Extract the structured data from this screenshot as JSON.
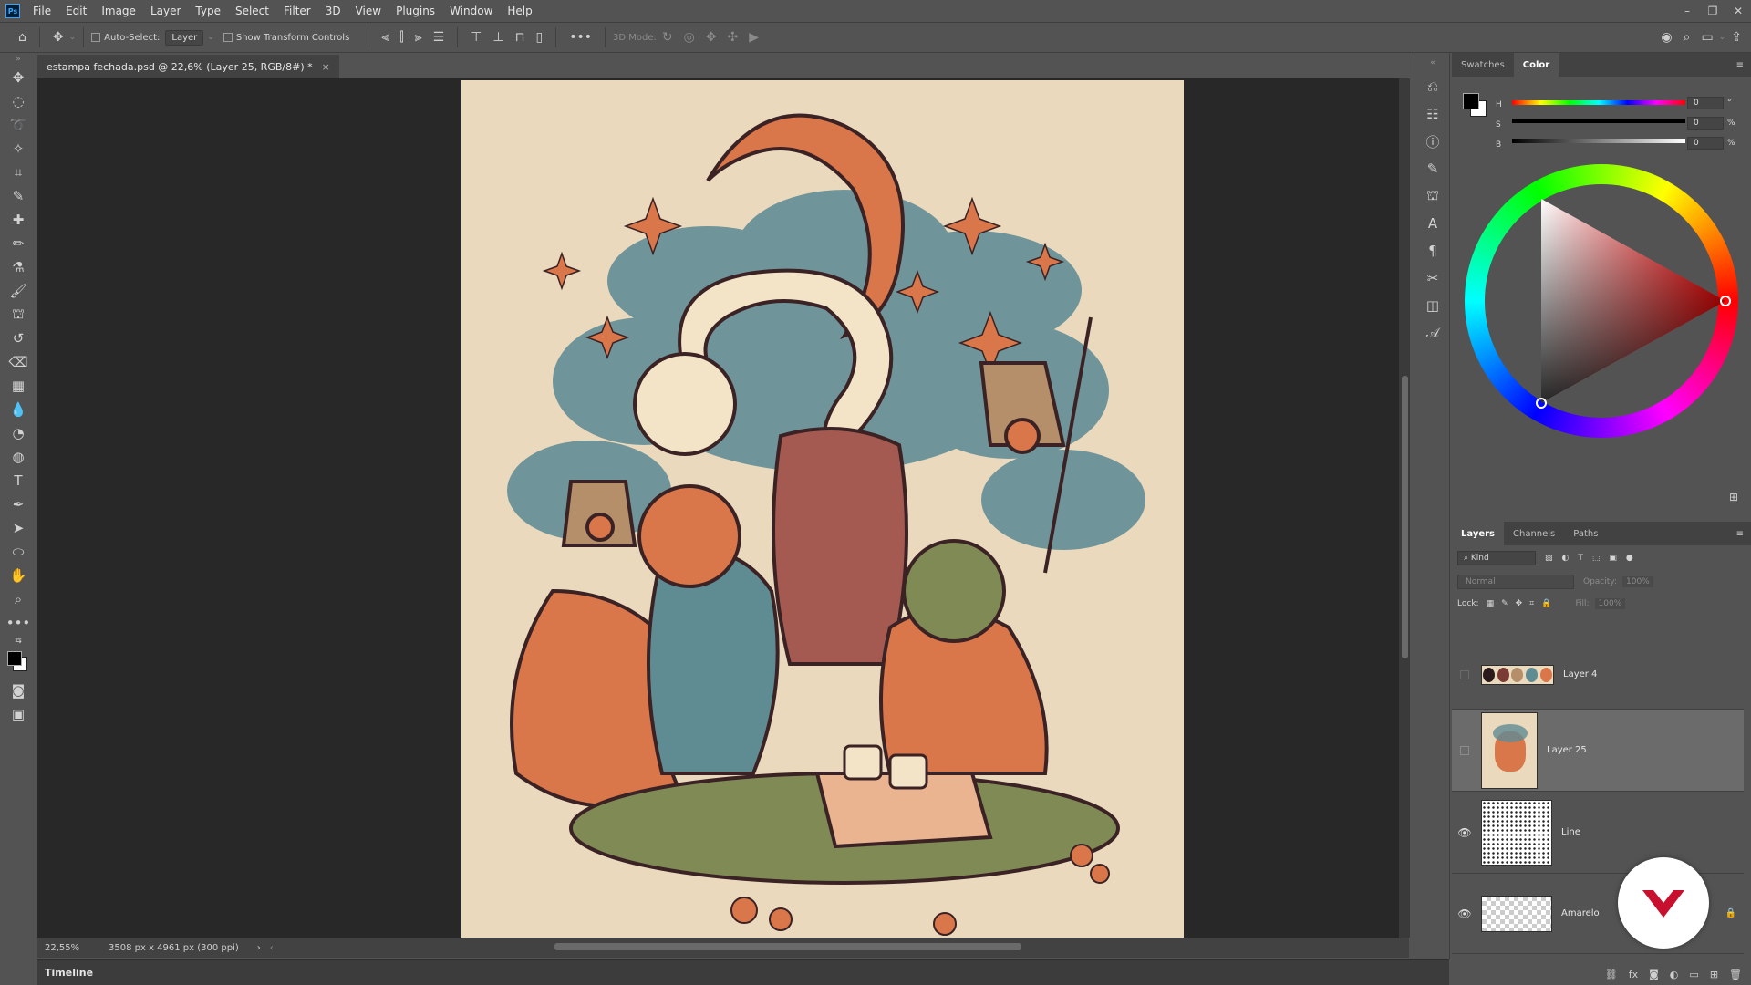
{
  "app": {
    "logo": "Ps"
  },
  "menu": [
    "File",
    "Edit",
    "Image",
    "Layer",
    "Type",
    "Select",
    "Filter",
    "3D",
    "View",
    "Plugins",
    "Window",
    "Help"
  ],
  "options": {
    "auto_select_label": "Auto-Select:",
    "auto_select_value": "Layer",
    "transform_label": "Show Transform Controls",
    "mode_3d_label": "3D Mode:"
  },
  "document": {
    "tab_title": "estampa fechada.psd @ 22,6% (Layer 25, RGB/8#) *",
    "zoom": "22,55%",
    "size_info": "3508 px x 4961 px (300 ppi)"
  },
  "timeline": {
    "label": "Timeline"
  },
  "color_panel": {
    "tabs": [
      "Swatches",
      "Color"
    ],
    "active_tab": "Color",
    "h_label": "H",
    "s_label": "S",
    "b_label": "B",
    "h_value": "0",
    "s_value": "0",
    "b_value": "0",
    "h_unit": "°",
    "s_unit": "%",
    "b_unit": "%",
    "foreground": "#000000",
    "background": "#ffffff"
  },
  "layers_panel": {
    "tabs": [
      "Layers",
      "Channels",
      "Paths"
    ],
    "active_tab": "Layers",
    "filter_kind": "Kind",
    "blend_mode": "Normal",
    "opacity_label": "Opacity:",
    "opacity_value": "100%",
    "lock_label": "Lock:",
    "fill_label": "Fill:",
    "fill_value": "100%",
    "layers": [
      {
        "name": "Layer 4",
        "visible": false,
        "selected": false
      },
      {
        "name": "Layer 25",
        "visible": false,
        "selected": true
      },
      {
        "name": "Line",
        "visible": true,
        "selected": false
      },
      {
        "name": "Amarelo",
        "visible": true,
        "selected": false,
        "locked": true
      }
    ]
  },
  "swatch_strip_colors": [
    "#2a1a1c",
    "#7a3b34",
    "#b58e6a",
    "#5f8b93",
    "#d9774a"
  ],
  "artwork_colors": {
    "background": "#ead9bc",
    "orange": "#d9774a",
    "teal": "#5f8b93",
    "cream": "#f3e4c8",
    "olive": "#7f8a55",
    "dark": "#3b2224"
  }
}
